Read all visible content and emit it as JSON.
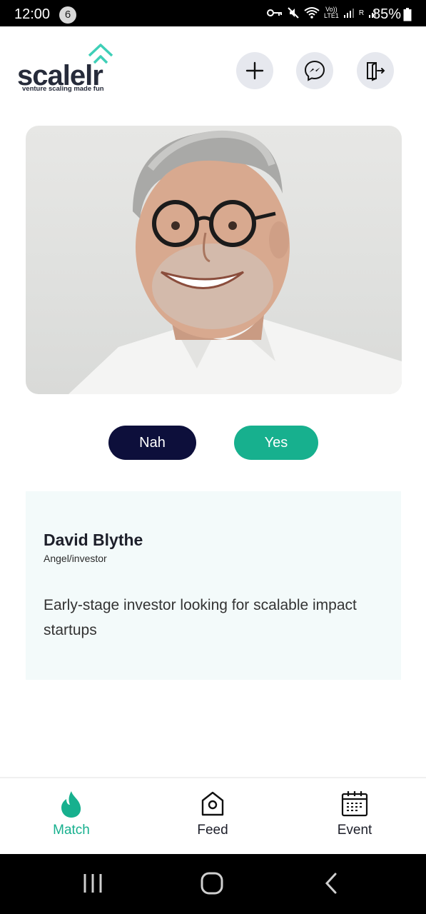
{
  "status_bar": {
    "time": "12:00",
    "notification_count": "6",
    "network_label_top": "Vo))",
    "network_label_bottom": "LTE1",
    "roaming": "R",
    "battery": "85%"
  },
  "header": {
    "logo_text": "scalelr",
    "logo_tagline": "venture scaling made fun",
    "icons": [
      "plus-icon",
      "messenger-icon",
      "logout-icon"
    ]
  },
  "profile": {
    "name": "David Blythe",
    "role": "Angel/investor",
    "bio": "Early-stage investor looking for scalable impact startups"
  },
  "actions": {
    "nah_label": "Nah",
    "yes_label": "Yes"
  },
  "tabs": [
    {
      "label": "Match",
      "icon": "flame-icon",
      "active": true
    },
    {
      "label": "Feed",
      "icon": "home-icon",
      "active": false
    },
    {
      "label": "Event",
      "icon": "calendar-icon",
      "active": false
    }
  ],
  "colors": {
    "accent": "#17b08e",
    "navy": "#0d0f3b",
    "card_bg": "#f3fafa"
  }
}
